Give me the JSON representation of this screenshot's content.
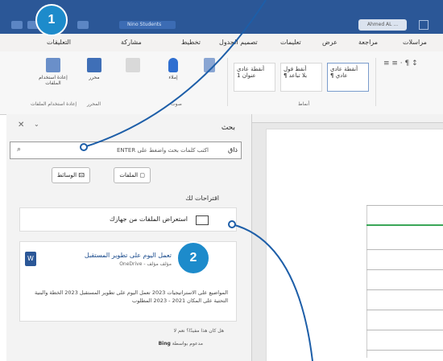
{
  "title_bar": {
    "app_label": "Nino Students",
    "search_text": "Ahmed AL ..."
  },
  "ribbon_tabs": [
    "مراسلات",
    "مراجعة",
    "عرض",
    "تعليمات",
    "تصميم الجدول",
    "تخطيط",
    "مشاركة",
    "التعليقات"
  ],
  "ribbon": {
    "styles": [
      {
        "line1": "أنقطة عادي",
        "line2": "¶ عادي"
      },
      {
        "line1": "أنقط فول",
        "line2": "¶ بلا تباعد"
      },
      {
        "line1": "أنقطة عادي",
        "line2": "عنوان 1"
      }
    ],
    "buttons": [
      "إملاء",
      "محرر",
      "إعادة استخدام الملفات"
    ],
    "groups": [
      "أنماط",
      "صوت",
      "المحرر",
      "إعادة استخدام الملفات"
    ]
  },
  "search_pane": {
    "title": "بحث",
    "search_label": "ذاق",
    "placeholder": "اكتب كلمات بحث واضغط على ENTER",
    "chips": [
      "الوسائط",
      "الملفات"
    ],
    "suggestions_header": "اقتراحات لك",
    "browse_label": "استعراض الملفات من جهازك",
    "result_title": "تعمل اليوم على تطوير المستقبل",
    "result_subtitle": "مؤلف مؤلف - OneDrive",
    "result_desc": "المواضيع على الاستراتيجيات 2023 تعمل اليوم على تطوير المستقبل 2023 الخطة والبنية التحتية على المكان 2021 - 2023 المطلوب",
    "helpful_text": "هل كان هذا مفيدًا؟ نعم لا",
    "powered_by": "مدعوم بواسطة",
    "bing": "Bing"
  },
  "callouts": [
    "1",
    "2"
  ],
  "colors": {
    "title_bar": "#2b5797",
    "callout": "#1d8bcb",
    "table_accent": "#3aa657"
  }
}
